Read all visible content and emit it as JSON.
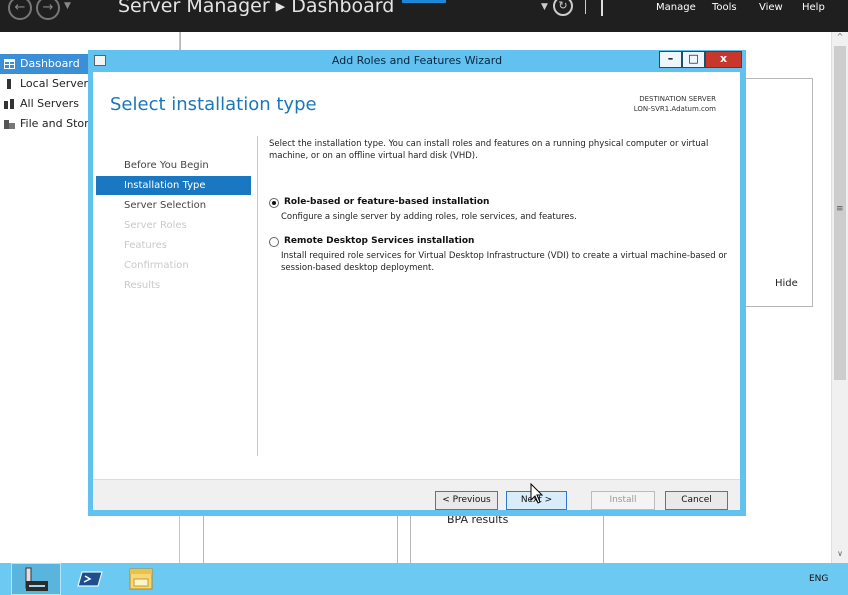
{
  "header": {
    "title": "Server Manager ▸ Dashboard",
    "menu": [
      "Manage",
      "Tools",
      "View",
      "Help"
    ]
  },
  "sidebar": {
    "items": [
      {
        "label": "Dashboard",
        "icon": "dashboard-icon",
        "selected": true
      },
      {
        "label": "Local Server",
        "icon": "server-icon"
      },
      {
        "label": "All Servers",
        "icon": "servers-icon"
      },
      {
        "label": "File and Storage Services",
        "icon": "storage-icon"
      }
    ]
  },
  "background": {
    "hide_label": "Hide",
    "bpa_label": "BPA results"
  },
  "wizard": {
    "window_title": "Add Roles and Features Wizard",
    "heading": "Select installation type",
    "destination_label": "DESTINATION SERVER",
    "destination_server": "LON-SVR1.Adatum.com",
    "nav_steps": [
      {
        "label": "Before You Begin",
        "state": "done"
      },
      {
        "label": "Installation Type",
        "state": "current"
      },
      {
        "label": "Server Selection",
        "state": "enabled"
      },
      {
        "label": "Server Roles",
        "state": "disabled"
      },
      {
        "label": "Features",
        "state": "disabled"
      },
      {
        "label": "Confirmation",
        "state": "disabled"
      },
      {
        "label": "Results",
        "state": "disabled"
      }
    ],
    "intro": "Select the installation type. You can install roles and features on a running physical computer or virtual machine, or on an offline virtual hard disk (VHD).",
    "options": [
      {
        "title": "Role-based or feature-based installation",
        "description": "Configure a single server by adding roles, role services, and features.",
        "selected": true
      },
      {
        "title": "Remote Desktop Services installation",
        "description": "Install required role services for Virtual Desktop Infrastructure (VDI) to create a virtual machine-based or session-based desktop deployment.",
        "selected": false
      }
    ],
    "buttons": {
      "previous": "< Previous",
      "next": "Next >",
      "install": "Install",
      "cancel": "Cancel"
    },
    "install_enabled": false
  },
  "taskbar": {
    "language": "ENG"
  },
  "colors": {
    "wizard_frame": "#61c2f0",
    "accent": "#1a78c2",
    "header_bg": "#1f1f1f",
    "close_button": "#c7372b",
    "taskbar": "#6bc9f2"
  }
}
